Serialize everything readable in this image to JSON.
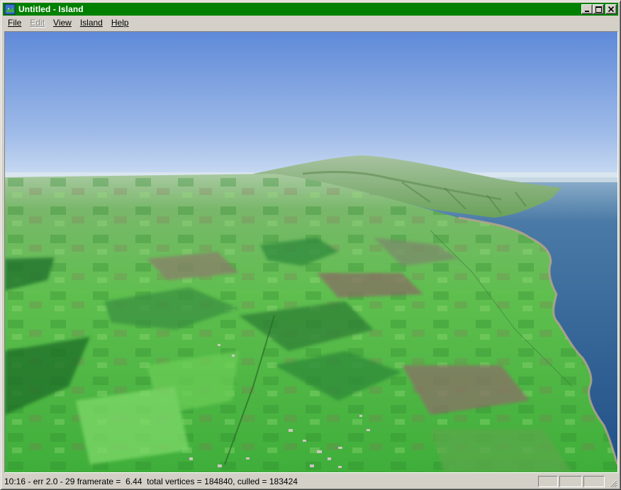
{
  "window": {
    "title": "Untitled - Island",
    "app_icon": "island-app-icon",
    "title_color": "#008000",
    "controls": {
      "minimize": "minimize-icon",
      "maximize": "maximize-icon",
      "close": "close-icon"
    }
  },
  "menu": {
    "items": [
      {
        "label": "File",
        "enabled": true
      },
      {
        "label": "Edit",
        "enabled": false
      },
      {
        "label": "View",
        "enabled": true
      },
      {
        "label": "Island",
        "enabled": true
      },
      {
        "label": "Help",
        "enabled": true
      }
    ]
  },
  "viewport": {
    "scene": "aerial-3d-terrain-island-coastline",
    "sky_color_top": "#5f8ad8",
    "sky_color_horizon": "#e3eef8",
    "ocean_color": "#2f5e8c",
    "land_color": "#4fbf45"
  },
  "status": {
    "text": "10:16 - err 2.0 - 29 framerate =  6.44  total vertices = 184840, culled = 183424"
  }
}
